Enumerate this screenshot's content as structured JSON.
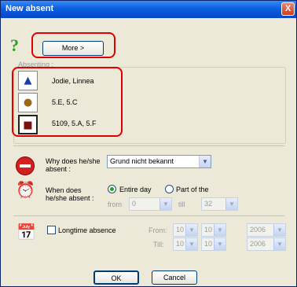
{
  "window": {
    "title": "New absent",
    "close_symbol": "X"
  },
  "more_button": {
    "label": "More >"
  },
  "absenting": {
    "label": "Absenting :",
    "items": [
      {
        "icon": "graduation-cap-icon",
        "text": "Jodie, Linnea"
      },
      {
        "icon": "teacher-icon",
        "text": "5.E, 5.C"
      },
      {
        "icon": "classroom-desk-icon",
        "text": "5109, 5.A, 5.F"
      }
    ]
  },
  "reason": {
    "label_line1": "Why does he/she",
    "label_line2": "absent :",
    "selected": "Grund nicht bekannt"
  },
  "when": {
    "label_line1": "When does",
    "label_line2": "he/she absent :",
    "entire_day": "Entire day",
    "part_of": "Part of the",
    "from_label": "from",
    "from_value": "0",
    "till_label": "till",
    "till_value": "32"
  },
  "longtime": {
    "checkbox_label": "Longtime absence",
    "from_label": "From:",
    "till_label": "Till:",
    "from": {
      "day": "10",
      "month": "10",
      "year": "2006"
    },
    "till": {
      "day": "10",
      "month": "10",
      "year": "2006"
    }
  },
  "buttons": {
    "ok": "OK",
    "cancel": "Cancel"
  }
}
